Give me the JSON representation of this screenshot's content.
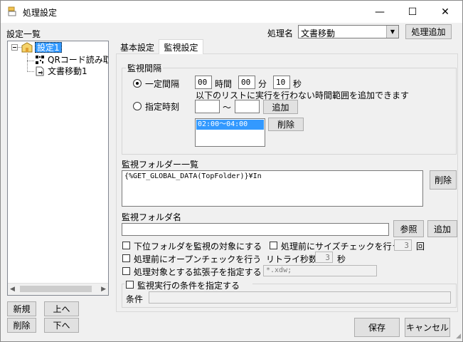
{
  "window": {
    "title": "処理設定",
    "minimize_glyph": "—",
    "maximize_glyph": "☐",
    "close_glyph": "✕"
  },
  "left": {
    "section_label": "設定一覧",
    "tree": {
      "root_label": "設定1",
      "children": [
        {
          "label": "QRコード読み取"
        },
        {
          "label": "文書移動1"
        }
      ]
    },
    "buttons": {
      "new": "新規",
      "up": "上へ",
      "delete": "削除",
      "down": "下へ"
    }
  },
  "process_name": {
    "label": "処理名",
    "value": "文書移動",
    "add_button": "処理追加"
  },
  "tabs": [
    {
      "label": "基本設定",
      "active": false
    },
    {
      "label": "監視設定",
      "active": true
    }
  ],
  "interval": {
    "group_label": "監視間隔",
    "fixed": {
      "label": "一定間隔",
      "selected": true,
      "hours": "00",
      "hours_unit": "時間",
      "minutes": "00",
      "minutes_unit": "分",
      "seconds": "10",
      "seconds_unit": "秒",
      "note": "以下のリストに実行を行わない時間範囲を追加できます"
    },
    "specified": {
      "label": "指定時刻",
      "selected": false,
      "from": "",
      "tilde": "〜",
      "to": "",
      "add_button": "追加",
      "delete_button": "削除",
      "ranges": [
        "02:00〜04:00"
      ]
    }
  },
  "folders": {
    "label": "監視フォルダー一覧",
    "items": [
      "{%GET_GLOBAL_DATA(TopFolder)}¥In"
    ],
    "delete_button": "削除",
    "name_label": "監視フォルダ名",
    "name_value": "",
    "browse_button": "参照",
    "add_button": "追加"
  },
  "options": {
    "subfolders": "下位フォルダを監視の対象にする",
    "size_check": "処理前にサイズチェックを行う",
    "size_check_count": "3",
    "size_check_unit": "回",
    "open_check": "処理前にオープンチェックを行う",
    "retry_label": "リトライ秒数",
    "retry_value": "3",
    "retry_unit": "秒",
    "ext_label": "処理対象とする拡張子を指定する",
    "ext_value": "*.xdw;"
  },
  "condition": {
    "group_label": "監視実行の条件を指定する",
    "field_label": "条件",
    "value": ""
  },
  "footer": {
    "save": "保存",
    "cancel": "キャンセル"
  },
  "colors": {
    "selection": "#3399ff",
    "window_bg": "#f0f0f0"
  }
}
